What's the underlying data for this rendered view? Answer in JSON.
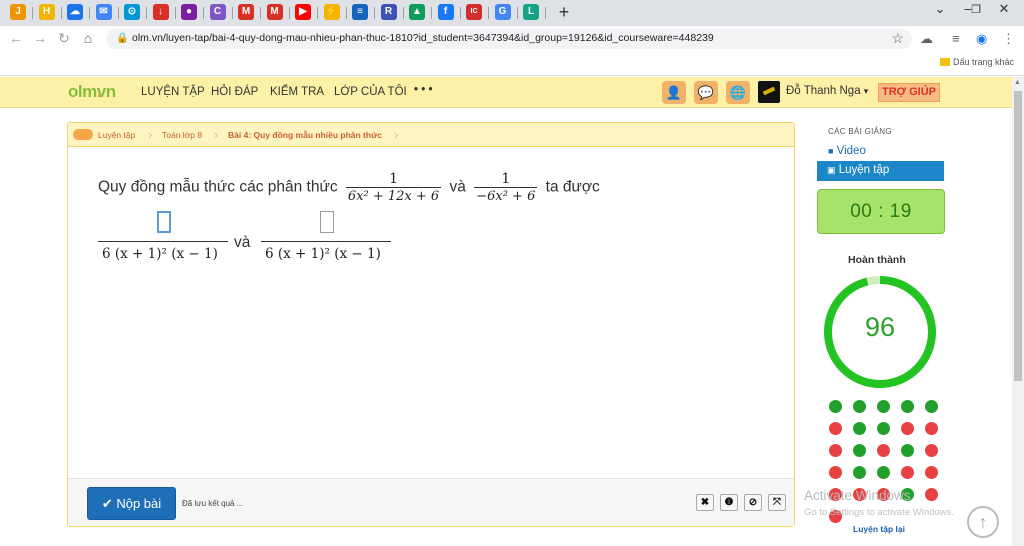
{
  "browser": {
    "tabs": [
      {
        "icon": "J",
        "color": "#f09300"
      },
      {
        "icon": "H",
        "color": "#f4b400"
      },
      {
        "icon": "☁",
        "color": "#1a73e8"
      },
      {
        "icon": "✉",
        "color": "#4285f4"
      },
      {
        "icon": "⊙",
        "color": "#0097d7"
      },
      {
        "icon": "↓",
        "color": "#d93025"
      },
      {
        "icon": "●",
        "color": "#7b1fa2"
      },
      {
        "icon": "C",
        "color": "#7e57c2"
      },
      {
        "icon": "M",
        "color": "#d93025"
      },
      {
        "icon": "M",
        "color": "#d93025"
      },
      {
        "icon": "▶",
        "color": "#ff0000"
      },
      {
        "icon": "⚡",
        "color": "#f4b400"
      },
      {
        "icon": "≡",
        "color": "#1565c0"
      },
      {
        "icon": "R",
        "color": "#3f51b5"
      },
      {
        "icon": "▲",
        "color": "#0f9d58"
      },
      {
        "icon": "f",
        "color": "#1877f2"
      },
      {
        "icon": "IC",
        "color": "#d32f2f"
      },
      {
        "icon": "G",
        "color": "#4285f4"
      },
      {
        "icon": "L",
        "color": "#16a085"
      }
    ],
    "new_tab": "+",
    "window_controls": {
      "minimize": "–",
      "maximize": "❐",
      "close": "✕",
      "dropdown": "⌄"
    },
    "url": "olm.vn/luyen-tap/bai-4-quy-dong-mau-nhieu-phan-thuc-1810?id_student=3647394&id_group=19126&id_courseware=448239",
    "other_bookmarks": "Dấu trang khác"
  },
  "site": {
    "logo_main": "olm",
    "logo_dot": ".",
    "logo_tld": "vn",
    "nav": [
      "LUYỆN TẬP",
      "HỎI ĐÁP",
      "KIỂM TRA",
      "LỚP CỦA TÔI",
      "• • •"
    ],
    "username": "Đỗ Thanh Nga",
    "user_caret": "▾",
    "help": "TRỢ GIÚP"
  },
  "breadcrumb": [
    "Luyện tập",
    "Toán lớp 8",
    "Bài 4: Quy đồng mẫu nhiều phân thức"
  ],
  "question": {
    "prefix": "Quy đồng mẫu thức các phân thức",
    "frac1_num": "1",
    "frac1_den": "6x² + 12x + 6",
    "and": "và",
    "frac2_num": "1",
    "frac2_den": "−6x² + 6",
    "suffix": "ta được",
    "answer_den": "6 (x + 1)² (x − 1)",
    "answer_and": "và"
  },
  "bottom": {
    "submit": "✔ Nộp bài",
    "saved": "Đã lưu kết quả ...",
    "tools": [
      "✖",
      "❶",
      "⊘",
      "⤧"
    ]
  },
  "sidebar": {
    "lectures_title": "CÁC BÀI GIẢNG",
    "video": "Video",
    "practice": "Luyện tập",
    "timer": "00 : 19",
    "complete_title": "Hoàn thành",
    "score": "96",
    "score_fraction": 0.96,
    "ring_color": "#22c322",
    "ring_bg": "#cfeec0",
    "results": [
      "g",
      "g",
      "g",
      "g",
      "g",
      "r",
      "g",
      "g",
      "r",
      "r",
      "r",
      "g",
      "r",
      "g",
      "r",
      "r",
      "g",
      "g",
      "r",
      "r",
      "r",
      "r",
      "r",
      "g",
      "r",
      "r"
    ],
    "retry": "Luyện tập lại"
  },
  "watermark": {
    "line1": "Activate Windows",
    "line2": "Go to Settings to activate Windows."
  }
}
